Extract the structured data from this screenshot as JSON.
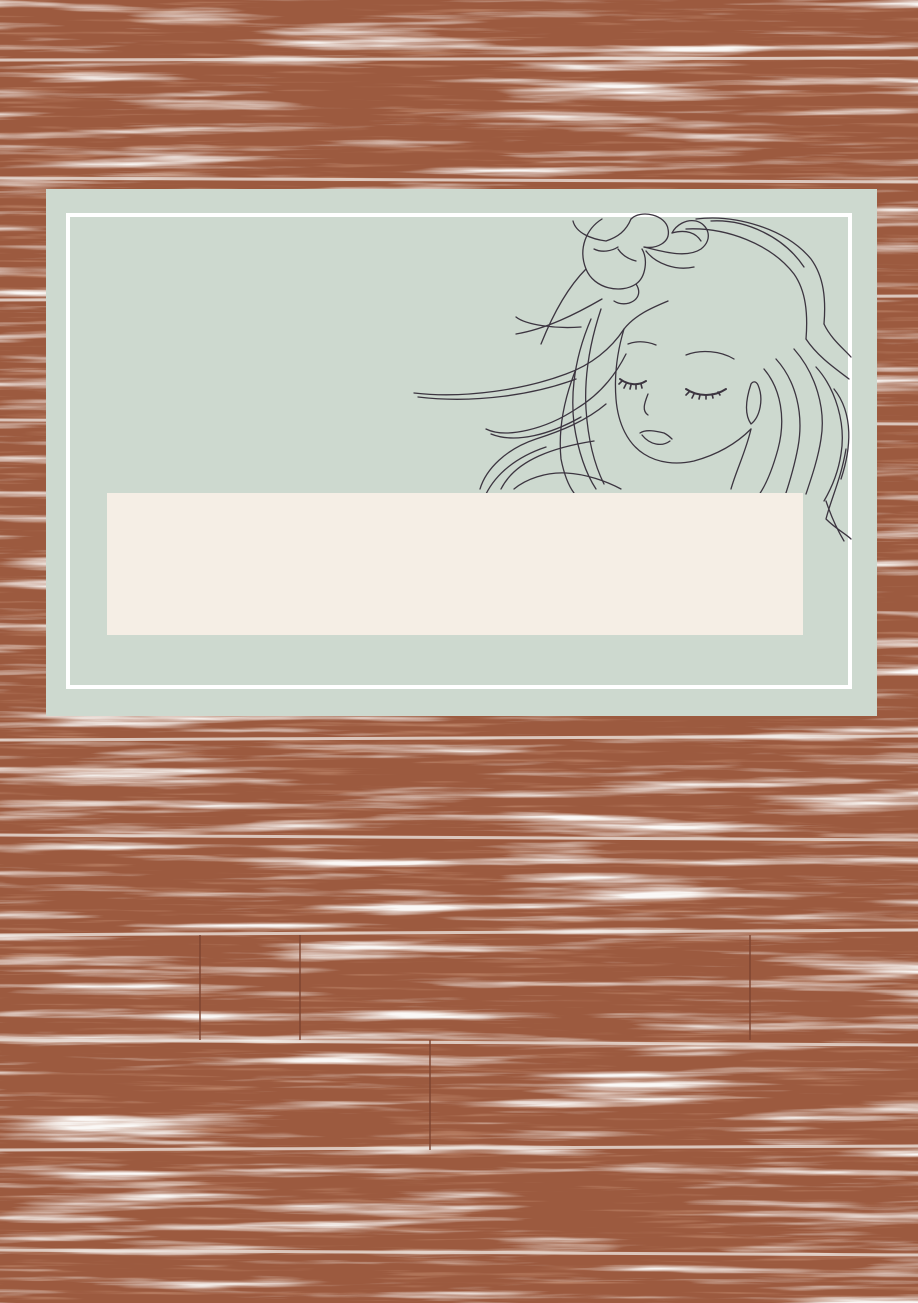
{
  "background": {
    "texture": "wood-planks",
    "wood_color": "#9c5a3f",
    "highlight_color": "#f4efeb"
  },
  "card": {
    "color": "#cdd9cf",
    "frame_color": "#ffffff",
    "illustration": "woman-with-flower-line-art-icon",
    "line_color": "#3c3540",
    "label_box": {
      "color": "#f5eee5",
      "text": ""
    }
  }
}
